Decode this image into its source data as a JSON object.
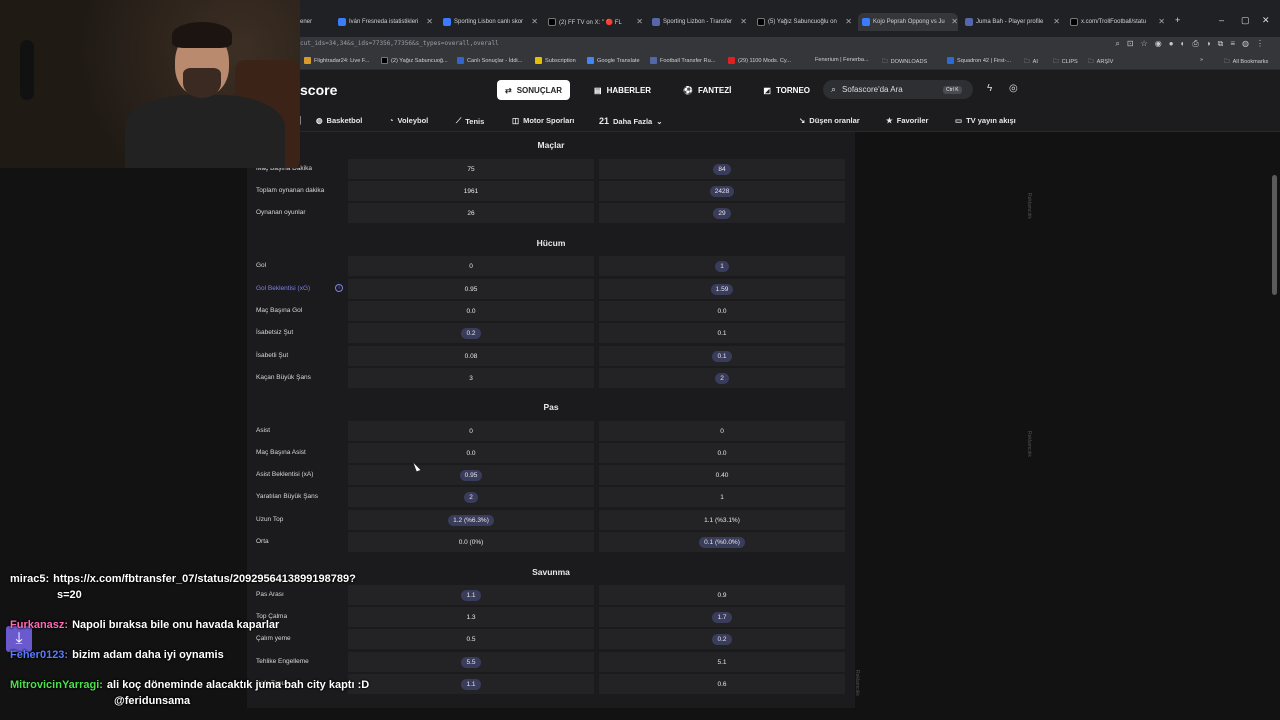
{
  "browser": {
    "tabs": [
      {
        "label": "ener",
        "color": "#888"
      },
      {
        "label": "Iván Fresneda istatistikleri",
        "color": "#3b7cff"
      },
      {
        "label": "Sporting Lisbon canlı skor",
        "color": "#3b7cff"
      },
      {
        "label": "(2) FF TV on X: \" 🔴 FL",
        "color": "#222"
      },
      {
        "label": "Sporting Lizbon - Transfer",
        "color": "#5566aa"
      },
      {
        "label": "(5) Yağız Sabuncuoğlu on",
        "color": "#222"
      },
      {
        "label": "Kojo Peprah Oppong vs Ju",
        "color": "#3b7cff"
      },
      {
        "label": "Juma Bah - Player profile",
        "color": "#5566aa"
      },
      {
        "label": "x.com/TrollFootball/statu",
        "color": "#222"
      }
    ],
    "url": "cut_ids=34,34&s_ids=77356,77356&s_types=overall,overall",
    "bookmarks": [
      "Flightradar24: Live F...",
      "(2) Yağız Sabuncuoğ...",
      "Canlı Sonuçlar - İddi...",
      "Subscription",
      "Google Translate",
      "Football Transfer Ru...",
      "(29) 1100 Mods. Cy...",
      "Fenerium | Fenerba...",
      "DOWNLOADS",
      "Squadron 42 | First-...",
      "AI",
      "CLIPS",
      "ARŞİV",
      "All Bookmarks"
    ]
  },
  "site": {
    "logo": "score",
    "nav": [
      {
        "label": "SONUÇLAR",
        "icon": "results-icon",
        "active": true
      },
      {
        "label": "HABERLER",
        "icon": "news-icon",
        "active": false
      },
      {
        "label": "FANTEZİ",
        "icon": "fantasy-icon",
        "active": false
      },
      {
        "label": "TORNEO",
        "icon": "torneo-icon",
        "active": false
      }
    ],
    "search_placeholder": "Sofascore'da Ara",
    "search_shortcut": "Ctrl K",
    "subnav": {
      "basketbol": "Basketbol",
      "voleybol": "Voleybol",
      "tenis": "Tenis",
      "motor": "Motor Sporları",
      "more_count": "21",
      "more": "Daha Fazla",
      "odds": "Düşen oranlar",
      "favorites": "Favoriler",
      "tv": "TV yayın akışı"
    }
  },
  "stats": {
    "sections": {
      "maclar": "Maçlar",
      "hucum": "Hücum",
      "pas": "Pas",
      "savunma": "Savunma"
    },
    "rows": [
      {
        "label": "Maç Başına Dakika",
        "left": "75",
        "right": "84",
        "lp": false,
        "rp": true
      },
      {
        "label": "Toplam oynanan dakika",
        "left": "1961",
        "right": "2428",
        "lp": false,
        "rp": true
      },
      {
        "label": "Oynanan oyunlar",
        "left": "26",
        "right": "29",
        "lp": false,
        "rp": true
      },
      {
        "label": "Gol",
        "left": "0",
        "right": "1",
        "lp": false,
        "rp": true
      },
      {
        "label": "Gol Beklentisi (xG)",
        "left": "0.95",
        "right": "1.59",
        "lp": false,
        "rp": true
      },
      {
        "label": "Maç Başına Gol",
        "left": "0.0",
        "right": "0.0",
        "lp": false,
        "rp": false
      },
      {
        "label": "İsabetsiz Şut",
        "left": "0.2",
        "right": "0.1",
        "lp": true,
        "rp": false
      },
      {
        "label": "İsabetli Şut",
        "left": "0.08",
        "right": "0.1",
        "lp": false,
        "rp": true
      },
      {
        "label": "Kaçan Büyük Şans",
        "left": "3",
        "right": "2",
        "lp": false,
        "rp": true
      },
      {
        "label": "Asist",
        "left": "0",
        "right": "0",
        "lp": false,
        "rp": false
      },
      {
        "label": "Maç Başına Asist",
        "left": "0.0",
        "right": "0.0",
        "lp": false,
        "rp": false
      },
      {
        "label": "Asist Beklentisi (xA)",
        "left": "0.95",
        "right": "0.40",
        "lp": true,
        "rp": false
      },
      {
        "label": "Yaratılan Büyük Şans",
        "left": "2",
        "right": "1",
        "lp": true,
        "rp": false
      },
      {
        "label": "Uzun Top",
        "left": "1.2 (%6.3%)",
        "right": "1.1 (%3.1%)",
        "lp": true,
        "rp": false
      },
      {
        "label": "Orta",
        "left": "0.0 (0%)",
        "right": "0.1 (%0.0%)",
        "lp": false,
        "rp": true
      },
      {
        "label": "Pas Arası",
        "left": "1.1",
        "right": "0.9",
        "lp": true,
        "rp": false
      },
      {
        "label": "Top Çalma",
        "left": "1.3",
        "right": "1.7",
        "lp": false,
        "rp": true
      },
      {
        "label": "Çalım yeme",
        "left": "0.5",
        "right": "0.2",
        "lp": false,
        "rp": true
      },
      {
        "label": "Tehlike Engelleme",
        "left": "5.5",
        "right": "5.1",
        "lp": true,
        "rp": false
      },
      {
        "label": "Kafa Topu",
        "left": "1.1",
        "right": "0.6",
        "lp": true,
        "rp": false
      }
    ]
  },
  "ads": {
    "label": "Reklamcılık"
  },
  "chat": [
    {
      "user": "mirac5:",
      "text": "https://x.com/fbtransfer_07/status/2092956413899198789?",
      "text2": "s=20",
      "color": "#ffffff"
    },
    {
      "user": "Furkanasz:",
      "text": "Napoli bıraksa bile onu havada kaparlar",
      "text2": "",
      "color": "#ff69b4"
    },
    {
      "user": "Feher0123:",
      "text": "bizim adam daha iyi oynamis",
      "text2": "",
      "color": "#5a7bff"
    },
    {
      "user": "MitrovicinYarragi:",
      "text": "ali koç döneminde alacaktık juma bah city kaptı :D",
      "text2": "@feridunsama",
      "color": "#4ce04c"
    }
  ],
  "colors": {
    "accent": "#7f7fe8",
    "pill": "#3a3c5c",
    "panel": "#1b1b1d"
  }
}
